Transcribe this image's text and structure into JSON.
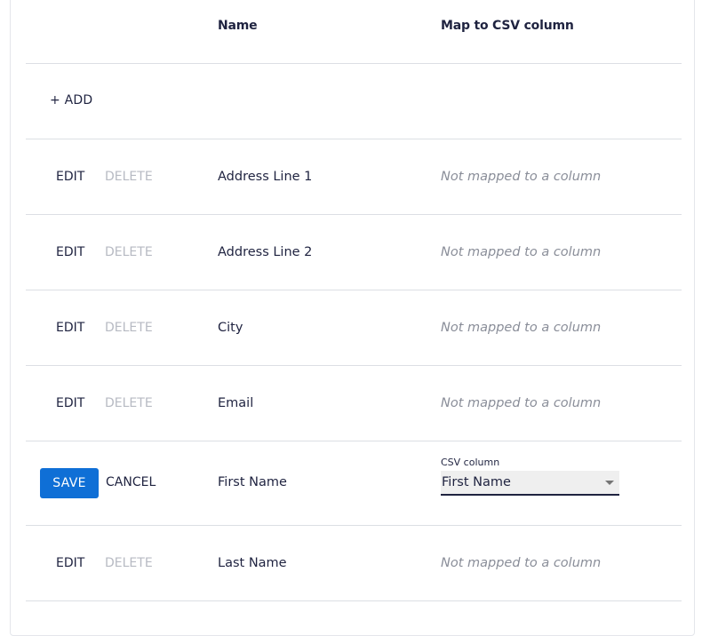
{
  "header": {
    "name": "Name",
    "map": "Map to CSV column"
  },
  "add_label": "+ ADD",
  "actions": {
    "edit": "EDIT",
    "delete": "DELETE",
    "save": "SAVE",
    "cancel": "CANCEL"
  },
  "rows": [
    {
      "name": "Address Line 1",
      "mapping": "Not mapped to a column"
    },
    {
      "name": "Address Line 2",
      "mapping": "Not mapped to a column"
    },
    {
      "name": "City",
      "mapping": "Not mapped to a column"
    },
    {
      "name": "Email",
      "mapping": "Not mapped to a column"
    },
    {
      "name": "First Name",
      "editing": true,
      "select_label": "CSV column",
      "select_value": "First Name"
    },
    {
      "name": "Last Name",
      "mapping": "Not mapped to a column"
    }
  ],
  "colors": {
    "primary": "#0f6fd6",
    "disabled": "#b7bac3",
    "text": "#1f2340"
  }
}
